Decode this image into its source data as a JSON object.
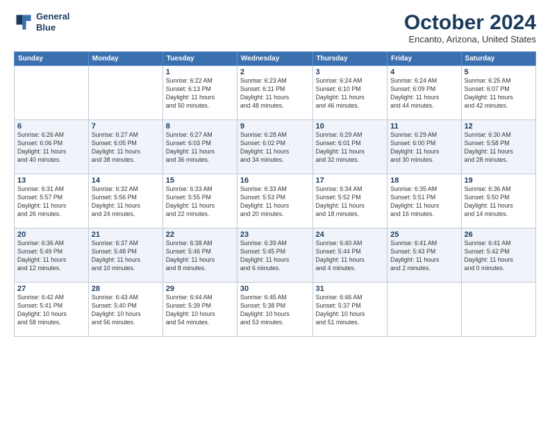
{
  "header": {
    "logo_line1": "General",
    "logo_line2": "Blue",
    "title": "October 2024",
    "location": "Encanto, Arizona, United States"
  },
  "days_of_week": [
    "Sunday",
    "Monday",
    "Tuesday",
    "Wednesday",
    "Thursday",
    "Friday",
    "Saturday"
  ],
  "weeks": [
    [
      {
        "day": "",
        "info": ""
      },
      {
        "day": "",
        "info": ""
      },
      {
        "day": "1",
        "info": "Sunrise: 6:22 AM\nSunset: 6:13 PM\nDaylight: 11 hours\nand 50 minutes."
      },
      {
        "day": "2",
        "info": "Sunrise: 6:23 AM\nSunset: 6:11 PM\nDaylight: 11 hours\nand 48 minutes."
      },
      {
        "day": "3",
        "info": "Sunrise: 6:24 AM\nSunset: 6:10 PM\nDaylight: 11 hours\nand 46 minutes."
      },
      {
        "day": "4",
        "info": "Sunrise: 6:24 AM\nSunset: 6:09 PM\nDaylight: 11 hours\nand 44 minutes."
      },
      {
        "day": "5",
        "info": "Sunrise: 6:25 AM\nSunset: 6:07 PM\nDaylight: 11 hours\nand 42 minutes."
      }
    ],
    [
      {
        "day": "6",
        "info": "Sunrise: 6:26 AM\nSunset: 6:06 PM\nDaylight: 11 hours\nand 40 minutes."
      },
      {
        "day": "7",
        "info": "Sunrise: 6:27 AM\nSunset: 6:05 PM\nDaylight: 11 hours\nand 38 minutes."
      },
      {
        "day": "8",
        "info": "Sunrise: 6:27 AM\nSunset: 6:03 PM\nDaylight: 11 hours\nand 36 minutes."
      },
      {
        "day": "9",
        "info": "Sunrise: 6:28 AM\nSunset: 6:02 PM\nDaylight: 11 hours\nand 34 minutes."
      },
      {
        "day": "10",
        "info": "Sunrise: 6:29 AM\nSunset: 6:01 PM\nDaylight: 11 hours\nand 32 minutes."
      },
      {
        "day": "11",
        "info": "Sunrise: 6:29 AM\nSunset: 6:00 PM\nDaylight: 11 hours\nand 30 minutes."
      },
      {
        "day": "12",
        "info": "Sunrise: 6:30 AM\nSunset: 5:58 PM\nDaylight: 11 hours\nand 28 minutes."
      }
    ],
    [
      {
        "day": "13",
        "info": "Sunrise: 6:31 AM\nSunset: 5:57 PM\nDaylight: 11 hours\nand 26 minutes."
      },
      {
        "day": "14",
        "info": "Sunrise: 6:32 AM\nSunset: 5:56 PM\nDaylight: 11 hours\nand 24 minutes."
      },
      {
        "day": "15",
        "info": "Sunrise: 6:33 AM\nSunset: 5:55 PM\nDaylight: 11 hours\nand 22 minutes."
      },
      {
        "day": "16",
        "info": "Sunrise: 6:33 AM\nSunset: 5:53 PM\nDaylight: 11 hours\nand 20 minutes."
      },
      {
        "day": "17",
        "info": "Sunrise: 6:34 AM\nSunset: 5:52 PM\nDaylight: 11 hours\nand 18 minutes."
      },
      {
        "day": "18",
        "info": "Sunrise: 6:35 AM\nSunset: 5:51 PM\nDaylight: 11 hours\nand 16 minutes."
      },
      {
        "day": "19",
        "info": "Sunrise: 6:36 AM\nSunset: 5:50 PM\nDaylight: 11 hours\nand 14 minutes."
      }
    ],
    [
      {
        "day": "20",
        "info": "Sunrise: 6:36 AM\nSunset: 5:49 PM\nDaylight: 11 hours\nand 12 minutes."
      },
      {
        "day": "21",
        "info": "Sunrise: 6:37 AM\nSunset: 5:48 PM\nDaylight: 11 hours\nand 10 minutes."
      },
      {
        "day": "22",
        "info": "Sunrise: 6:38 AM\nSunset: 5:46 PM\nDaylight: 11 hours\nand 8 minutes."
      },
      {
        "day": "23",
        "info": "Sunrise: 6:39 AM\nSunset: 5:45 PM\nDaylight: 11 hours\nand 6 minutes."
      },
      {
        "day": "24",
        "info": "Sunrise: 6:40 AM\nSunset: 5:44 PM\nDaylight: 11 hours\nand 4 minutes."
      },
      {
        "day": "25",
        "info": "Sunrise: 6:41 AM\nSunset: 5:43 PM\nDaylight: 11 hours\nand 2 minutes."
      },
      {
        "day": "26",
        "info": "Sunrise: 6:41 AM\nSunset: 5:42 PM\nDaylight: 11 hours\nand 0 minutes."
      }
    ],
    [
      {
        "day": "27",
        "info": "Sunrise: 6:42 AM\nSunset: 5:41 PM\nDaylight: 10 hours\nand 58 minutes."
      },
      {
        "day": "28",
        "info": "Sunrise: 6:43 AM\nSunset: 5:40 PM\nDaylight: 10 hours\nand 56 minutes."
      },
      {
        "day": "29",
        "info": "Sunrise: 6:44 AM\nSunset: 5:39 PM\nDaylight: 10 hours\nand 54 minutes."
      },
      {
        "day": "30",
        "info": "Sunrise: 6:45 AM\nSunset: 5:38 PM\nDaylight: 10 hours\nand 53 minutes."
      },
      {
        "day": "31",
        "info": "Sunrise: 6:46 AM\nSunset: 5:37 PM\nDaylight: 10 hours\nand 51 minutes."
      },
      {
        "day": "",
        "info": ""
      },
      {
        "day": "",
        "info": ""
      }
    ]
  ]
}
